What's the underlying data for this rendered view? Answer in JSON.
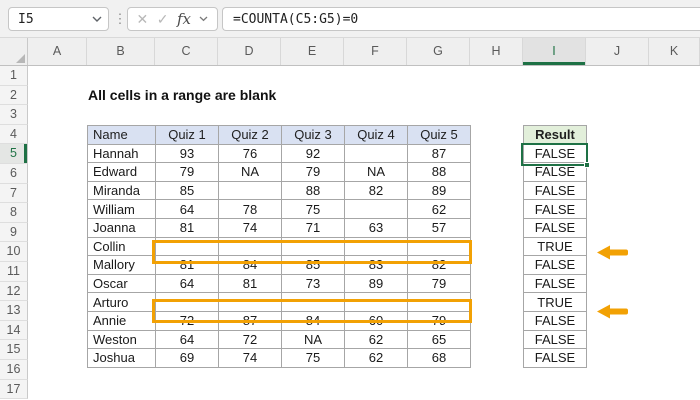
{
  "formula_bar": {
    "name_box_value": "I5",
    "formula": "=COUNTA(C5:G5)=0",
    "cancel_label": "✕",
    "enter_label": "✓",
    "fx_label": "fx",
    "drag_dots": "⋮"
  },
  "grid": {
    "col_letters": [
      "A",
      "B",
      "C",
      "D",
      "E",
      "F",
      "G",
      "H",
      "I",
      "J",
      "K"
    ],
    "row_numbers": [
      "1",
      "2",
      "3",
      "4",
      "5",
      "6",
      "7",
      "8",
      "9",
      "10",
      "11",
      "12",
      "13",
      "14",
      "15",
      "16",
      "17"
    ],
    "selected_cell": "I5",
    "selected_col": "I",
    "selected_row": "5"
  },
  "sheet": {
    "title": "All cells in a range are blank"
  },
  "table": {
    "headers": [
      "Name",
      "Quiz 1",
      "Quiz 2",
      "Quiz 3",
      "Quiz 4",
      "Quiz 5"
    ],
    "rows": [
      {
        "name": "Hannah",
        "scores": [
          "93",
          "76",
          "92",
          "",
          "87"
        ]
      },
      {
        "name": "Edward",
        "scores": [
          "79",
          "NA",
          "79",
          "NA",
          "88"
        ]
      },
      {
        "name": "Miranda",
        "scores": [
          "85",
          "",
          "88",
          "82",
          "89"
        ]
      },
      {
        "name": "William",
        "scores": [
          "64",
          "78",
          "75",
          "",
          "62"
        ]
      },
      {
        "name": "Joanna",
        "scores": [
          "81",
          "74",
          "71",
          "63",
          "57"
        ]
      },
      {
        "name": "Collin",
        "scores": [
          "",
          "",
          "",
          "",
          ""
        ]
      },
      {
        "name": "Mallory",
        "scores": [
          "81",
          "84",
          "85",
          "83",
          "82"
        ]
      },
      {
        "name": "Oscar",
        "scores": [
          "64",
          "81",
          "73",
          "89",
          "79"
        ]
      },
      {
        "name": "Arturo",
        "scores": [
          "",
          "",
          "",
          "",
          ""
        ]
      },
      {
        "name": "Annie",
        "scores": [
          "72",
          "87",
          "84",
          "60",
          "79"
        ]
      },
      {
        "name": "Weston",
        "scores": [
          "64",
          "72",
          "NA",
          "62",
          "65"
        ]
      },
      {
        "name": "Joshua",
        "scores": [
          "69",
          "74",
          "75",
          "62",
          "68"
        ]
      }
    ]
  },
  "result": {
    "header": "Result",
    "values": [
      "FALSE",
      "FALSE",
      "FALSE",
      "FALSE",
      "FALSE",
      "TRUE",
      "FALSE",
      "FALSE",
      "TRUE",
      "FALSE",
      "FALSE",
      "FALSE"
    ]
  },
  "colors": {
    "accent_green": "#1E7145",
    "table_header_fill": "#D9E1F2",
    "result_header_fill": "#E2EFDA",
    "highlight_orange": "#F2A104"
  }
}
